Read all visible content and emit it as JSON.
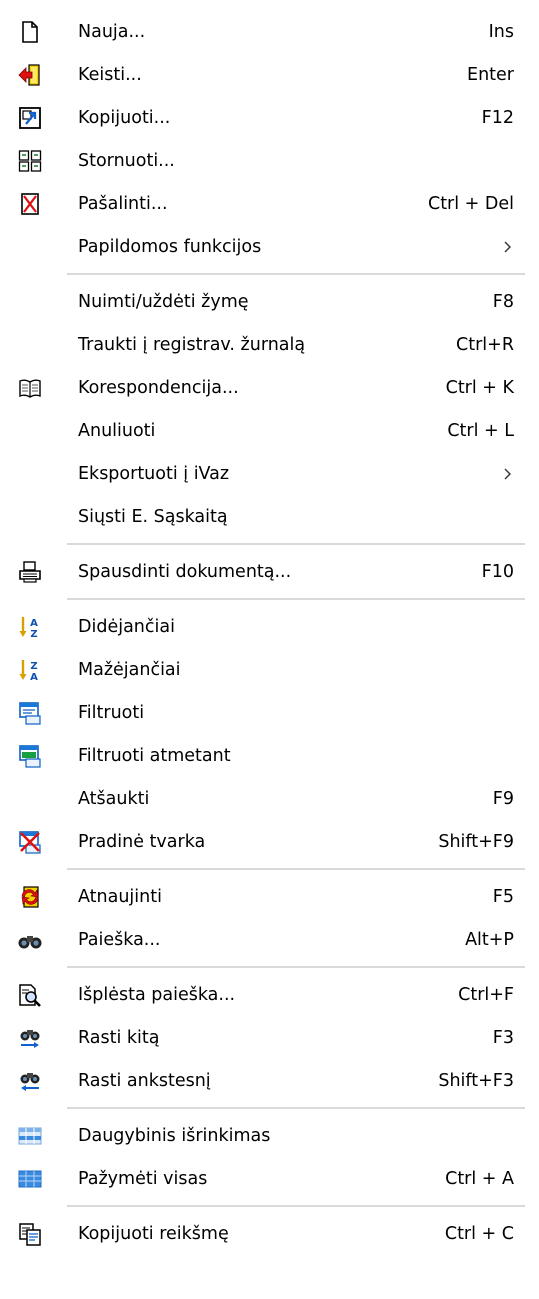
{
  "menu": {
    "items": [
      {
        "label": "Nauja...",
        "shortcut": "Ins",
        "icon": "new-document-icon"
      },
      {
        "label": "Keisti...",
        "shortcut": "Enter",
        "icon": "edit-icon"
      },
      {
        "label": "Kopijuoti...",
        "shortcut": "F12",
        "icon": "copy-icon"
      },
      {
        "label": "Stornuoti...",
        "shortcut": "",
        "icon": "storno-icon"
      },
      {
        "label": "Pašalinti...",
        "shortcut": "Ctrl + Del",
        "icon": "delete-icon"
      },
      {
        "label": "Papildomos funkcijos",
        "shortcut": "",
        "icon": "",
        "submenu": true
      },
      {
        "label": "Nuimti/uždėti žymę",
        "shortcut": "F8",
        "icon": ""
      },
      {
        "label": "Traukti į registrav. žurnalą",
        "shortcut": "Ctrl+R",
        "icon": ""
      },
      {
        "label": "Korespondencija...",
        "shortcut": "Ctrl + K",
        "icon": "book-icon"
      },
      {
        "label": "Anuliuoti",
        "shortcut": "Ctrl + L",
        "icon": ""
      },
      {
        "label": "Eksportuoti į iVaz",
        "shortcut": "",
        "icon": "",
        "submenu": true
      },
      {
        "label": "Siųsti E. Sąskaitą",
        "shortcut": "",
        "icon": ""
      },
      {
        "label": "Spausdinti dokumentą...",
        "shortcut": "F10",
        "icon": "printer-icon"
      },
      {
        "label": "Didėjančiai",
        "shortcut": "",
        "icon": "sort-ascending-icon"
      },
      {
        "label": "Mažėjančiai",
        "shortcut": "",
        "icon": "sort-descending-icon"
      },
      {
        "label": "Filtruoti",
        "shortcut": "",
        "icon": "filter-icon"
      },
      {
        "label": "Filtruoti atmetant",
        "shortcut": "",
        "icon": "filter-exclude-icon"
      },
      {
        "label": "Atšaukti",
        "shortcut": "F9",
        "icon": ""
      },
      {
        "label": "Pradinė tvarka",
        "shortcut": "Shift+F9",
        "icon": "reset-order-icon"
      },
      {
        "label": "Atnaujinti",
        "shortcut": "F5",
        "icon": "refresh-icon"
      },
      {
        "label": "Paieška...",
        "shortcut": "Alt+P",
        "icon": "binoculars-icon"
      },
      {
        "label": "Išplėsta paieška...",
        "shortcut": "Ctrl+F",
        "icon": "advanced-search-icon"
      },
      {
        "label": "Rasti kitą",
        "shortcut": "F3",
        "icon": "find-next-icon"
      },
      {
        "label": "Rasti ankstesnį",
        "shortcut": "Shift+F3",
        "icon": "find-previous-icon"
      },
      {
        "label": "Daugybinis išrinkimas",
        "shortcut": "",
        "icon": "multi-select-icon"
      },
      {
        "label": "Pažymėti visas",
        "shortcut": "Ctrl + A",
        "icon": "select-all-icon"
      },
      {
        "label": "Kopijuoti reikšmę",
        "shortcut": "Ctrl + C",
        "icon": "copy-value-icon"
      }
    ]
  },
  "colors": {
    "separator": "#d9d9d9",
    "text": "#000000",
    "background": "#ffffff"
  }
}
